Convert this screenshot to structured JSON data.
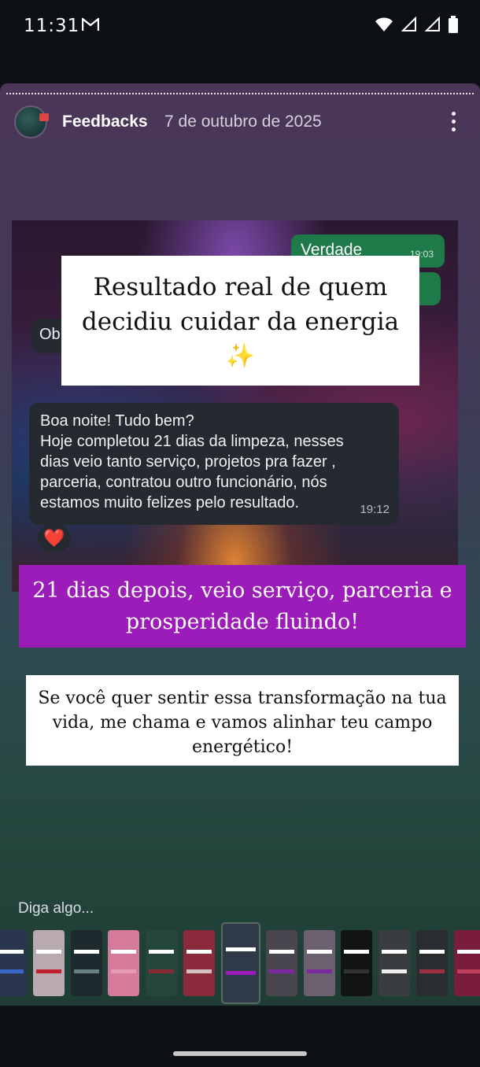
{
  "status_bar": {
    "time": "11:31",
    "icons": [
      "gmail-icon",
      "wifi-icon",
      "signal-icon",
      "signal-icon",
      "battery-icon"
    ]
  },
  "story": {
    "username": "Feedbacks",
    "date": "7 de outubro de 2025",
    "menu_icon": "more-vertical-icon",
    "reply_placeholder": "Diga algo..."
  },
  "screenshot": {
    "bubble_verdade": "Verdade",
    "bubble_verdade_time": "19:03",
    "bubble_ob": "Ob",
    "message_lines": [
      "Boa noite! Tudo bem?",
      "Hoje completou 21 dias da limpeza, nesses",
      "dias veio tanto serviço, projetos pra fazer ,",
      "parceria,  contratou outro funcionário, nós",
      "estamos muito felizes pelo resultado."
    ],
    "message_time": "19:12",
    "reaction": "❤️"
  },
  "cards": {
    "top_line1": "Resultado real de quem",
    "top_line2": "decidiu cuidar da energia",
    "top_sparkle": "✨",
    "purple_line1": "21 dias depois, veio serviço, parceria e",
    "purple_line2": "prosperidade fluindo!",
    "white_line1": "Se você quer sentir essa transformação na tua",
    "white_line2": "vida, me chama e vamos alinhar teu campo",
    "white_line3": "energético!"
  },
  "thumbnails": [
    {
      "color": "#2a3550",
      "accent": "#3a66c8"
    },
    {
      "color": "#b9a9b0",
      "accent": "#c02030"
    },
    {
      "color": "#1d2a2e",
      "accent": "#6a7f80"
    },
    {
      "color": "#d67a9c",
      "accent": "#e79ab6"
    },
    {
      "color": "#25463a",
      "accent": "#8a2a35"
    },
    {
      "color": "#8b2a3a",
      "accent": "#d3c0c0"
    },
    {
      "color": "#2f3a48",
      "accent": "#9b1cb8",
      "active": true
    },
    {
      "color": "#4a4650",
      "accent": "#7c2aa0"
    },
    {
      "color": "#6a6070",
      "accent": "#7c2aa0"
    },
    {
      "color": "#111315",
      "accent": "#333"
    },
    {
      "color": "#3a3d40",
      "accent": "#eee"
    },
    {
      "color": "#2a2d30",
      "accent": "#9a3040"
    },
    {
      "color": "#7a1d3a",
      "accent": "#c04060"
    }
  ]
}
